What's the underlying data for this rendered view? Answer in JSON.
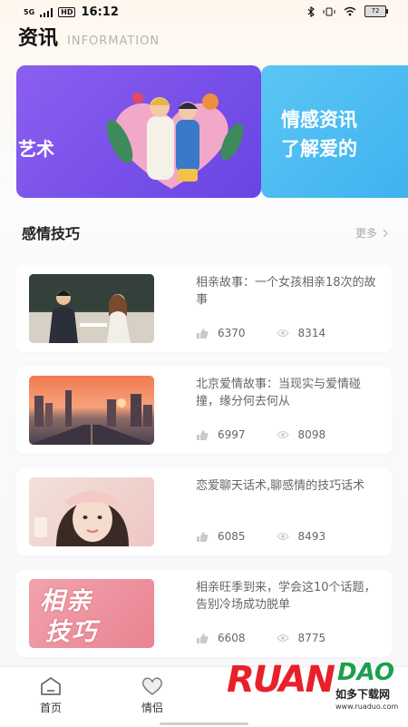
{
  "status": {
    "signal": "5G",
    "hd": "HD",
    "time": "16:12",
    "battery": "72"
  },
  "header": {
    "title": "资讯",
    "subtitle": "INFORMATION"
  },
  "banner": {
    "card1_text": "艺术",
    "card2_line1": "情感资讯",
    "card2_line2": "了解爱的"
  },
  "section": {
    "title": "感情技巧",
    "more": "更多"
  },
  "articles": [
    {
      "title": "相亲故事：一个女孩相亲18次的故事",
      "likes": "6370",
      "views": "8314"
    },
    {
      "title": "北京爱情故事：当现实与爱情碰撞，缘分何去何从",
      "likes": "6997",
      "views": "8098"
    },
    {
      "title": "恋爱聊天话术,聊感情的技巧话术",
      "likes": "6085",
      "views": "8493"
    },
    {
      "title": "相亲旺季到来，学会这10个话题，告别冷场成功脱单",
      "likes": "6608",
      "views": "8775"
    }
  ],
  "thumb4": {
    "line1": "相亲",
    "line2": "技巧"
  },
  "nav": {
    "home": "首页",
    "couple": "情侣"
  },
  "watermark": {
    "brand_main": "RUAN",
    "brand_sub": "DAO",
    "cn": "如多下载网",
    "url": "www.ruaduo.com"
  },
  "colors": {
    "banner_purple": "#7a50ea",
    "banner_blue": "#4cbcf2",
    "accent_red": "#e8202a"
  }
}
